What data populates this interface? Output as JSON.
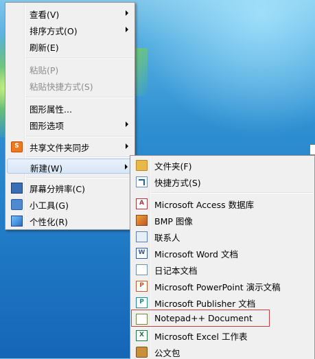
{
  "context_menu": {
    "items": [
      {
        "label": "查看(V)",
        "submenu": true
      },
      {
        "label": "排序方式(O)",
        "submenu": true
      },
      {
        "label": "刷新(E)"
      },
      {
        "label": "粘贴(P)",
        "disabled": true
      },
      {
        "label": "粘贴快捷方式(S)",
        "disabled": true
      },
      {
        "label": "图形属性..."
      },
      {
        "label": "图形选项",
        "submenu": true
      },
      {
        "label": "共享文件夹同步",
        "submenu": true,
        "icon": "shared-sync-icon"
      },
      {
        "label": "新建(W)",
        "submenu": true,
        "highlighted": true
      },
      {
        "label": "屏幕分辨率(C)",
        "icon": "screen-resolution-icon"
      },
      {
        "label": "小工具(G)",
        "icon": "gadgets-icon"
      },
      {
        "label": "个性化(R)",
        "icon": "personalize-icon"
      }
    ]
  },
  "new_submenu": {
    "items": [
      {
        "label": "文件夹(F)",
        "icon": "folder-icon"
      },
      {
        "label": "快捷方式(S)",
        "icon": "shortcut-icon"
      },
      {
        "label": "Microsoft Access 数据库",
        "icon": "access-icon"
      },
      {
        "label": "BMP 图像",
        "icon": "bmp-icon"
      },
      {
        "label": "联系人",
        "icon": "contact-icon"
      },
      {
        "label": "Microsoft Word 文档",
        "icon": "word-icon"
      },
      {
        "label": "日记本文档",
        "icon": "journal-icon"
      },
      {
        "label": "Microsoft PowerPoint 演示文稿",
        "icon": "powerpoint-icon"
      },
      {
        "label": "Microsoft Publisher 文档",
        "icon": "publisher-icon"
      },
      {
        "label": "Notepad++ Document",
        "icon": "notepadpp-icon",
        "boxed": true
      },
      {
        "label": "Microsoft Excel 工作表",
        "icon": "excel-icon"
      },
      {
        "label": "公文包",
        "icon": "briefcase-icon"
      }
    ]
  },
  "colors": {
    "menu_bg": "#f0f0f0",
    "highlight_box": "#cc3b3b",
    "desktop": "#1f78c4"
  }
}
